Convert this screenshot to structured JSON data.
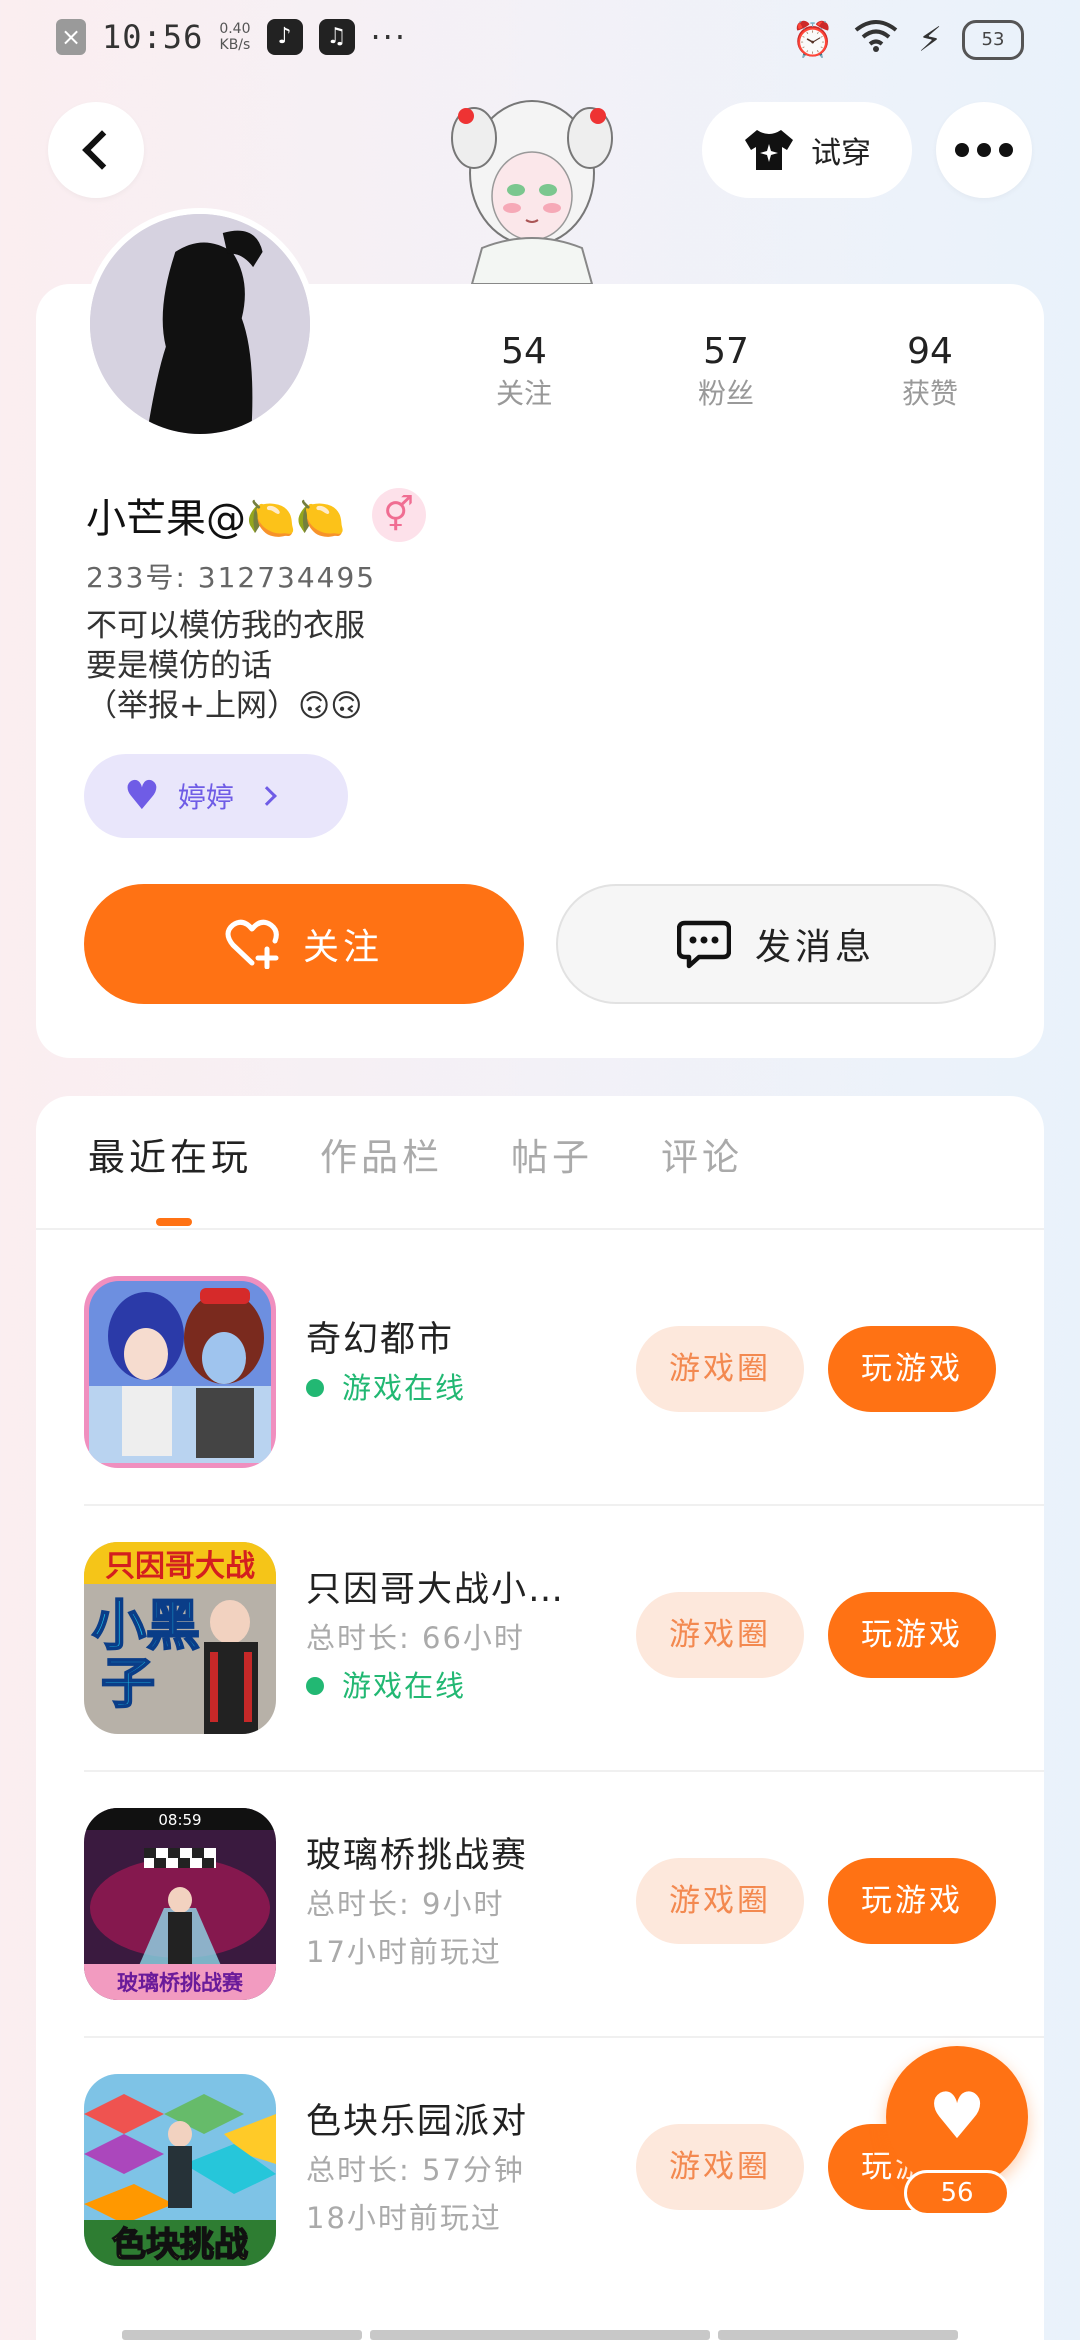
{
  "status_bar": {
    "time": "10:56",
    "net_speed_value": "0.40",
    "net_speed_unit": "KB/s",
    "more": "···",
    "battery": "53"
  },
  "nav": {
    "tryon_label": "试穿"
  },
  "profile": {
    "stats": [
      {
        "value": "54",
        "label": "关注"
      },
      {
        "value": "57",
        "label": "粉丝"
      },
      {
        "value": "94",
        "label": "获赞"
      }
    ],
    "name": "小芒果@🍋🍋",
    "gender_symbol": "⚥",
    "id_line": "233号: 312734495",
    "bio": [
      "不可以模仿我的衣服",
      "要是模仿的话",
      "（举报+上网）🙃🙃"
    ],
    "friend_chip": {
      "name": "婷婷"
    },
    "follow_label": "关注",
    "message_label": "发消息"
  },
  "tabs": [
    {
      "label": "最近在玩",
      "active": true
    },
    {
      "label": "作品栏",
      "active": false
    },
    {
      "label": "帖子",
      "active": false
    },
    {
      "label": "评论",
      "active": false
    }
  ],
  "games": [
    {
      "title": "奇幻都市",
      "lines": [],
      "online": "游戏在线",
      "circle_label": "游戏圈",
      "play_label": "玩游戏",
      "thumb_color": "#6d8fe0"
    },
    {
      "title": "只因哥大战小…",
      "lines": [
        "总时长: 66小时"
      ],
      "online": "游戏在线",
      "circle_label": "游戏圈",
      "play_label": "玩游戏",
      "thumb_text": [
        "只因哥大战",
        "小黑",
        "子"
      ],
      "thumb_color": "#b7b1a8"
    },
    {
      "title": "玻璃桥挑战赛",
      "lines": [
        "总时长: 9小时",
        "17小时前玩过"
      ],
      "circle_label": "游戏圈",
      "play_label": "玩游戏",
      "thumb_text": [
        "08:59",
        "玻璃桥挑战赛"
      ],
      "thumb_color": "#3a1a3f"
    },
    {
      "title": "色块乐园派对",
      "lines": [
        "总时长: 57分钟",
        "18小时前玩过"
      ],
      "circle_label": "游戏圈",
      "play_label": "玩游戏",
      "thumb_text": [
        "色块挑战"
      ],
      "thumb_color": "#7ec3e6"
    }
  ],
  "fab": {
    "count": "56"
  }
}
